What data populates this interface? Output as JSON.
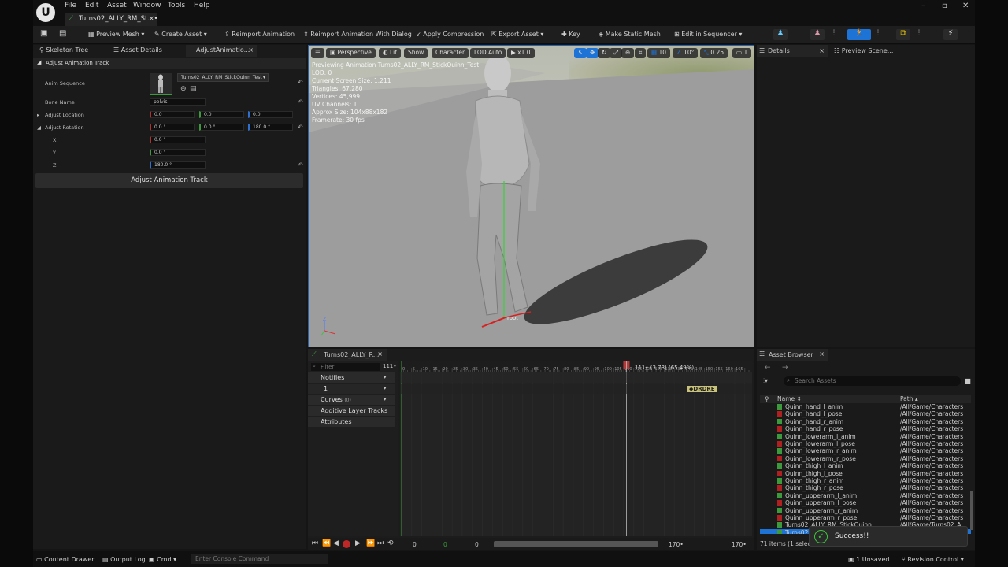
{
  "title_bar": {
    "menu": [
      "File",
      "Edit",
      "Asset",
      "Window",
      "Tools",
      "Help"
    ],
    "document_tab": "Turns02_ALLY_RM_St...•",
    "window_buttons": [
      "minimize",
      "maximize",
      "close"
    ]
  },
  "toolbar": {
    "preview_mesh": "Preview Mesh",
    "create_asset": "Create Asset",
    "reimport": "Reimport Animation",
    "reimport_dialog": "Reimport Animation With Dialog",
    "apply_compression": "Apply Compression",
    "export_asset": "Export Asset",
    "key": "Key",
    "make_static_mesh": "Make Static Mesh",
    "edit_in_sequencer": "Edit in Sequencer",
    "accent_color": "#1e74d6"
  },
  "left_panel": {
    "tabs": [
      "Skeleton Tree",
      "Asset Details",
      "AdjustAnimatio..."
    ],
    "section": "Adjust Animation Track",
    "anim_sequence_label": "Anim Sequence",
    "anim_sequence_value": "Turns02_ALLY_RM_StickQuinn_Test",
    "bone_name_label": "Bone Name",
    "bone_name_value": "pelvis",
    "adjust_location_label": "Adjust Location",
    "adjust_location": [
      "0.0",
      "0.0",
      "0.0"
    ],
    "adjust_rotation_label": "Adjust Rotation",
    "adjust_rotation": [
      "0.0 °",
      "0.0 °",
      "180.0 °"
    ],
    "x_label": "X",
    "x_value": "0.0 °",
    "y_label": "Y",
    "y_value": "0.0 °",
    "z_label": "Z",
    "z_value": "180.0 °",
    "button": "Adjust Animation Track"
  },
  "viewport": {
    "perspective": "Perspective",
    "lit": "Lit",
    "show": "Show",
    "character": "Character",
    "lod": "LOD Auto",
    "speed": "x1.0",
    "grid": "10",
    "angle": "10°",
    "scale": "0.25",
    "cam": "1",
    "stats": [
      "Previewing Animation Turns02_ALLY_RM_StickQuinn_Test",
      "LOD: 0",
      "Current Screen Size: 1.211",
      "Triangles: 67,280",
      "Vertices: 45,999",
      "UV Channels: 1",
      "Approx Size: 104x88x182",
      "Framerate: 30 fps"
    ],
    "root_label": "root"
  },
  "details_panel": {
    "tabs": [
      "Details",
      "Preview Scene..."
    ]
  },
  "timeline": {
    "tab": "Turns02_ALLY_R...",
    "filter_placeholder": "Filter",
    "frame_field": "111",
    "tracks": [
      {
        "label": "Notifies",
        "count": ""
      },
      {
        "label": "1",
        "count": ""
      },
      {
        "label": "Curves",
        "count": "(0)"
      },
      {
        "label": "Additive Layer Tracks",
        "count": ""
      },
      {
        "label": "Attributes",
        "count": ""
      }
    ],
    "ruler": [
      "0",
      "5",
      "10",
      "15",
      "20",
      "25",
      "30",
      "35",
      "40",
      "45",
      "50",
      "55",
      "60",
      "65",
      "70",
      "75",
      "80",
      "85",
      "90",
      "95",
      "100",
      "105",
      "110",
      "115",
      "120",
      "125",
      "130",
      "135",
      "140",
      "145",
      "150",
      "155",
      "160",
      "165"
    ],
    "scrubber_label": "111• (3.73) (65.49%)",
    "scrubber_progress": 0.6549,
    "notify_tag": "DRDRE",
    "transport_start": "0",
    "transport_current": "0",
    "transport_range_start": "0",
    "transport_end": "170",
    "transport_end2": "170"
  },
  "asset_browser": {
    "title": "Asset Browser",
    "search_placeholder": "Search Assets",
    "col_name": "Name",
    "col_path": "Path",
    "rows": [
      {
        "name": "Quinn_hand_l_anim",
        "path": "/All/Game/Characters",
        "color": "#3c9a3c"
      },
      {
        "name": "Quinn_hand_l_pose",
        "path": "/All/Game/Characters",
        "color": "#b02020"
      },
      {
        "name": "Quinn_hand_r_anim",
        "path": "/All/Game/Characters",
        "color": "#3c9a3c"
      },
      {
        "name": "Quinn_hand_r_pose",
        "path": "/All/Game/Characters",
        "color": "#b02020"
      },
      {
        "name": "Quinn_lowerarm_l_anim",
        "path": "/All/Game/Characters",
        "color": "#3c9a3c"
      },
      {
        "name": "Quinn_lowerarm_l_pose",
        "path": "/All/Game/Characters",
        "color": "#b02020"
      },
      {
        "name": "Quinn_lowerarm_r_anim",
        "path": "/All/Game/Characters",
        "color": "#3c9a3c"
      },
      {
        "name": "Quinn_lowerarm_r_pose",
        "path": "/All/Game/Characters",
        "color": "#b02020"
      },
      {
        "name": "Quinn_thigh_l_anim",
        "path": "/All/Game/Characters",
        "color": "#3c9a3c"
      },
      {
        "name": "Quinn_thigh_l_pose",
        "path": "/All/Game/Characters",
        "color": "#b02020"
      },
      {
        "name": "Quinn_thigh_r_anim",
        "path": "/All/Game/Characters",
        "color": "#3c9a3c"
      },
      {
        "name": "Quinn_thigh_r_pose",
        "path": "/All/Game/Characters",
        "color": "#b02020"
      },
      {
        "name": "Quinn_upperarm_l_anim",
        "path": "/All/Game/Characters",
        "color": "#3c9a3c"
      },
      {
        "name": "Quinn_upperarm_l_pose",
        "path": "/All/Game/Characters",
        "color": "#b02020"
      },
      {
        "name": "Quinn_upperarm_r_anim",
        "path": "/All/Game/Characters",
        "color": "#3c9a3c"
      },
      {
        "name": "Quinn_upperarm_r_pose",
        "path": "/All/Game/Characters",
        "color": "#b02020"
      },
      {
        "name": "Turns02_ALLY_RM_StickQuinn",
        "path": "/All/Game/Turns02_A",
        "color": "#3c9a3c"
      },
      {
        "name": "Turns02",
        "path": "",
        "color": "#3c9a3c"
      }
    ],
    "count": "71 items (1 selec"
  },
  "toast": {
    "text": "Success!!"
  },
  "status_bar": {
    "content_drawer": "Content Drawer",
    "output_log": "Output Log",
    "cmd": "Cmd",
    "console_placeholder": "Enter Console Command",
    "unsaved": "1 Unsaved",
    "revision_control": "Revision Control"
  }
}
